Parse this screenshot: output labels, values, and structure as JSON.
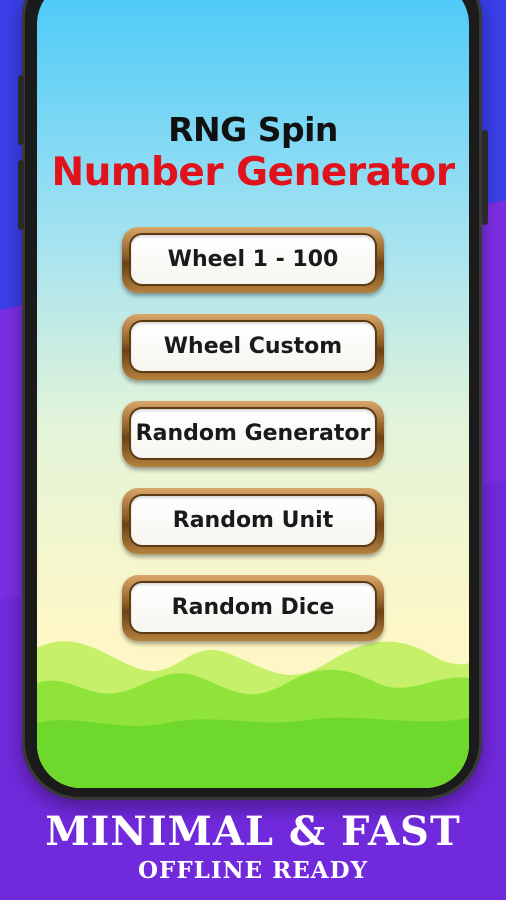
{
  "app": {
    "title_line1": "RNG Spin",
    "title_line2": "Number Generator",
    "title_color": "#111111",
    "subtitle_color": "#e0121b"
  },
  "menu": {
    "items": [
      {
        "label": "Wheel 1 - 100"
      },
      {
        "label": "Wheel Custom"
      },
      {
        "label": "Random Generator"
      },
      {
        "label": "Random Unit"
      },
      {
        "label": "Random Dice"
      }
    ]
  },
  "footer": {
    "headline": "MINIMAL & FAST",
    "tagline": "OFFLINE READY"
  },
  "colors": {
    "background_purple": "#5a2fe0",
    "background_blue": "#3b3fe6",
    "sky_top": "#48c9f8",
    "hills_light": "#b8f05a",
    "hills_dark": "#6fd82d",
    "button_border": "#8a5a26"
  }
}
